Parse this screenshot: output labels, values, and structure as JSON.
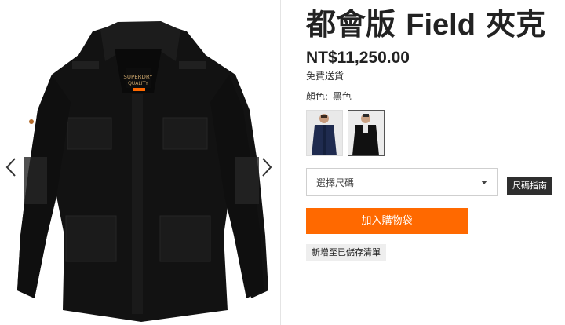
{
  "product": {
    "title_cjk_1": "都會版 ",
    "title_latin": "Field",
    "title_cjk_2": " 夾克",
    "price": "NT$11,250.00",
    "shipping": "免費送貨",
    "color_label": "顏色:",
    "color_value": "黑色"
  },
  "gallery": {
    "prev_icon": "chevron-left-icon",
    "next_icon": "chevron-right-icon"
  },
  "swatches": [
    {
      "color": "navy",
      "selected": false
    },
    {
      "color": "black",
      "selected": true
    }
  ],
  "size_select": {
    "placeholder": "選擇尺碼"
  },
  "buttons": {
    "size_guide": "尺碼指南",
    "add_to_bag": "加入購物袋",
    "add_to_wishlist": "新增至已儲存清單"
  },
  "colors": {
    "accent": "#ff6900",
    "dark_button": "#2e2e2e"
  }
}
